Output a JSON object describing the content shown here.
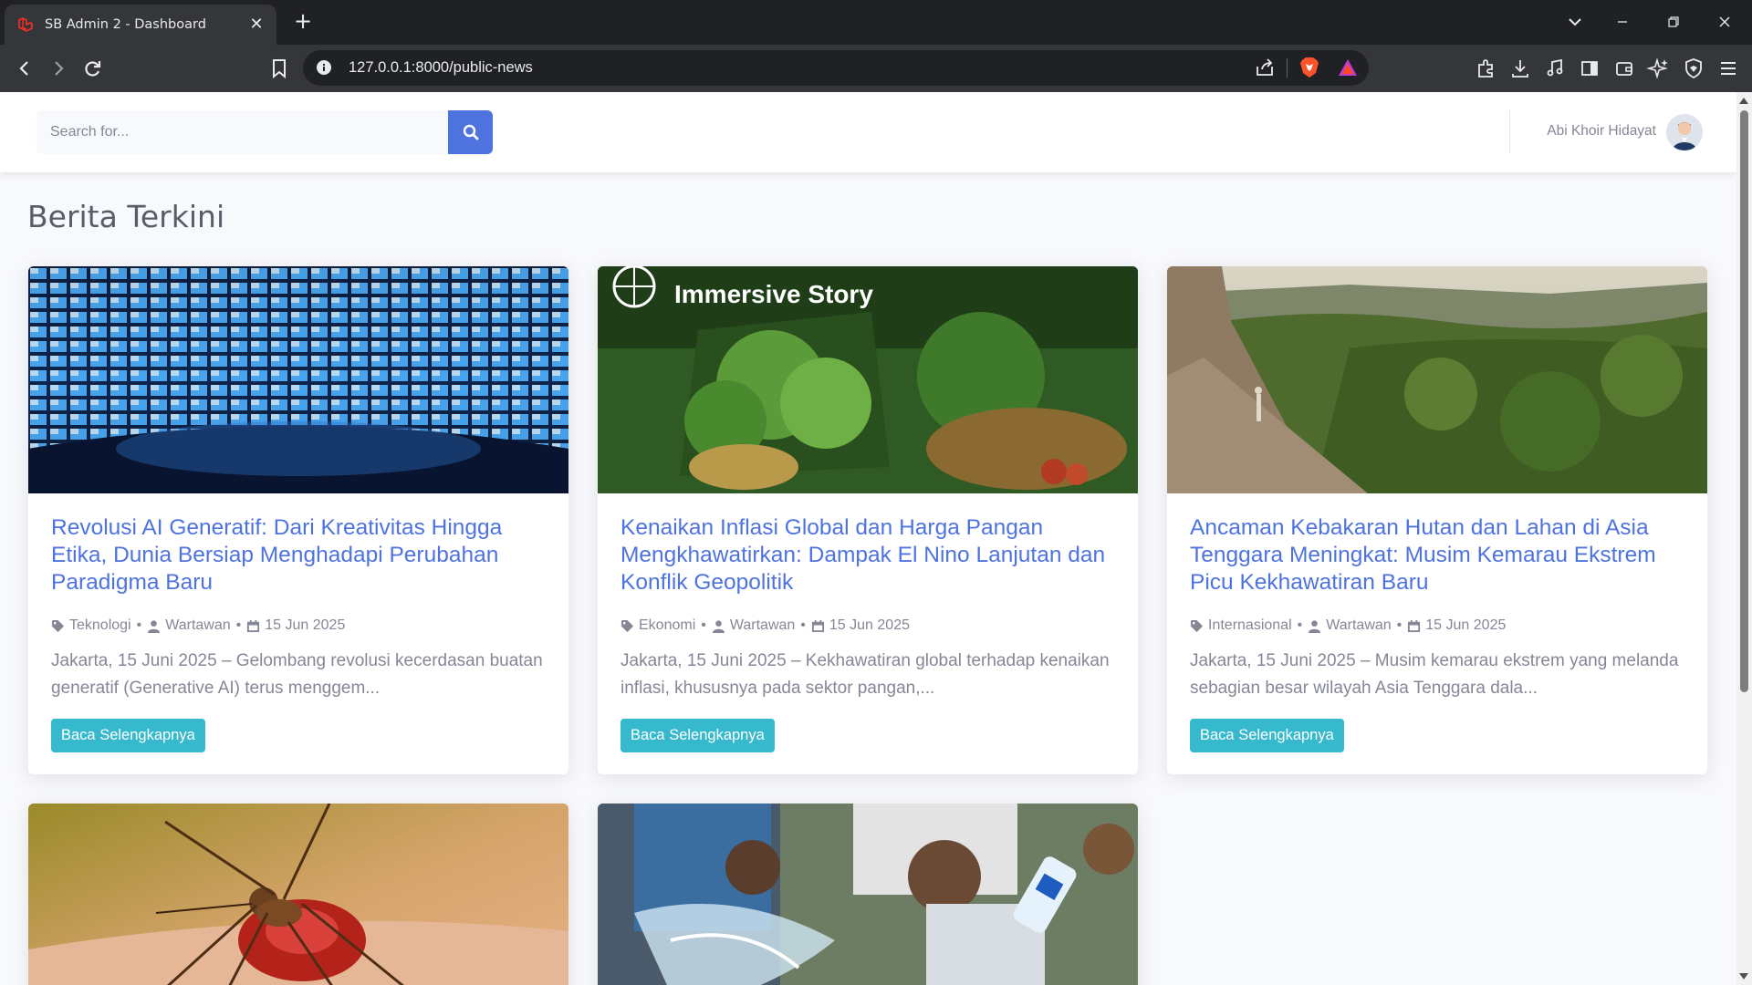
{
  "browser": {
    "tab_title": "SB Admin 2 - Dashboard",
    "url": "127.0.0.1:8000/public-news"
  },
  "topbar": {
    "search_placeholder": "Search for...",
    "user_name": "Abi Khoir Hidayat"
  },
  "page": {
    "heading": "Berita Terkini"
  },
  "articles": [
    {
      "title": "Revolusi AI Generatif: Dari Kreativitas Hingga Etika, Dunia Bersiap Menghadapi Perubahan Paradigma Baru",
      "category": "Teknologi",
      "author": "Wartawan",
      "date": "15 Jun 2025",
      "excerpt": "Jakarta, 15 Juni 2025 – Gelombang revolusi kecerdasan buatan generatif (Generative AI) terus menggem...",
      "button": "Baca Selengkapnya",
      "image": "video-wall-screens"
    },
    {
      "title": "Kenaikan Inflasi Global dan Harga Pangan Mengkhawatirkan: Dampak El Nino Lanjutan dan Konflik Geopolitik",
      "category": "Ekonomi",
      "author": "Wartawan",
      "date": "15 Jun 2025",
      "excerpt": "Jakarta, 15 Juni 2025 – Kekhawatiran global terhadap kenaikan inflasi, khususnya pada sektor pangan,...",
      "button": "Baca Selengkapnya",
      "image": "vegetables-basket",
      "image_caption": "Immersive Story"
    },
    {
      "title": "Ancaman Kebakaran Hutan dan Lahan di Asia Tenggara Meningkat: Musim Kemarau Ekstrem Picu Kekhawatiran Baru",
      "category": "Internasional",
      "author": "Wartawan",
      "date": "15 Jun 2025",
      "excerpt": "Jakarta, 15 Juni 2025 – Musim kemarau ekstrem yang melanda sebagian besar wilayah Asia Tenggara dala...",
      "button": "Baca Selengkapnya",
      "image": "forest-landscape"
    },
    {
      "image": "mosquito"
    },
    {
      "image": "people-water"
    }
  ],
  "colors": {
    "primary": "#4e73df",
    "info": "#36b9cc",
    "text_muted": "#858796",
    "heading": "#5a5c69",
    "page_bg": "#f8f9fc"
  }
}
